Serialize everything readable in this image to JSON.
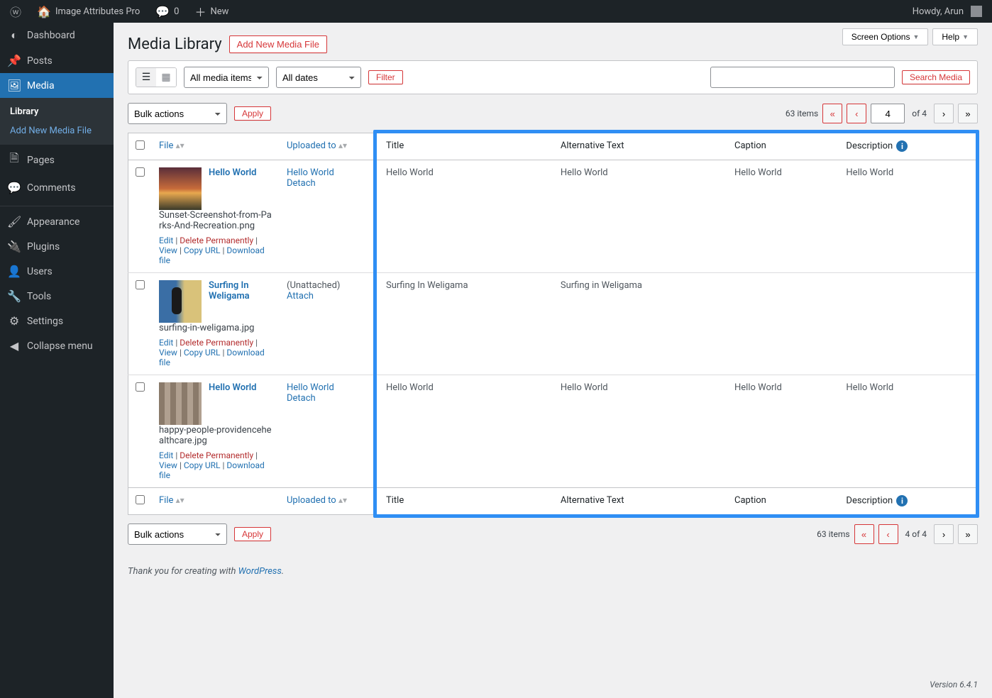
{
  "admin_bar": {
    "site_name": "Image Attributes Pro",
    "comments_count": "0",
    "new_label": "New",
    "howdy": "Howdy, Arun"
  },
  "sidebar": {
    "items": [
      {
        "label": "Dashboard",
        "icon": "◐"
      },
      {
        "label": "Posts",
        "icon": "📌"
      },
      {
        "label": "Media",
        "icon": "🖼",
        "current": true,
        "sub": [
          {
            "label": "Library",
            "current": true
          },
          {
            "label": "Add New Media File",
            "link": true
          }
        ]
      },
      {
        "label": "Pages",
        "icon": "🗎"
      },
      {
        "label": "Comments",
        "icon": "💬"
      },
      {
        "sep": true
      },
      {
        "label": "Appearance",
        "icon": "🖌"
      },
      {
        "label": "Plugins",
        "icon": "🔌"
      },
      {
        "label": "Users",
        "icon": "👤"
      },
      {
        "label": "Tools",
        "icon": "🔧"
      },
      {
        "label": "Settings",
        "icon": "⚙"
      },
      {
        "label": "Collapse menu",
        "icon": "◀"
      }
    ]
  },
  "top_buttons": {
    "screen_options": "Screen Options",
    "help": "Help"
  },
  "page": {
    "title": "Media Library",
    "add_new": "Add New Media File"
  },
  "filters": {
    "media_items": "All media items",
    "dates": "All dates",
    "filter_btn": "Filter",
    "search_btn": "Search Media"
  },
  "bulk": {
    "label": "Bulk actions",
    "apply": "Apply"
  },
  "pagination_top": {
    "items": "63 items",
    "page": "4",
    "of": "of 4"
  },
  "pagination_bottom": {
    "items": "63 items",
    "page_of": "4 of 4"
  },
  "columns": {
    "file": "File",
    "uploaded": "Uploaded to",
    "title": "Title",
    "alt": "Alternative Text",
    "caption": "Caption",
    "desc": "Description"
  },
  "row_actions": {
    "edit": "Edit",
    "delete": "Delete Permanently",
    "view": "View",
    "copy": "Copy URL",
    "download": "Download file",
    "detach": "Detach",
    "attach": "Attach",
    "unattached": "(Unattached)"
  },
  "rows": [
    {
      "thumb": "sunset",
      "name": "Hello World",
      "filename": "Sunset-Screenshot-from-Parks-And-Recreation.png",
      "uploaded": "Hello World",
      "uploaded_action": "Detach",
      "title": "Hello World",
      "alt": "Hello World",
      "caption": "Hello World",
      "desc": "Hello World"
    },
    {
      "thumb": "surf",
      "name": "Surfing In Weligama",
      "filename": "surfing-in-weligama.jpg",
      "uploaded": "(Unattached)",
      "uploaded_action": "Attach",
      "unattached": true,
      "title": "Surfing In Weligama",
      "alt": "Surfing in Weligama",
      "caption": "",
      "desc": ""
    },
    {
      "thumb": "people",
      "name": "Hello World",
      "filename": "happy-people-providencehealthcare.jpg",
      "uploaded": "Hello World",
      "uploaded_action": "Detach",
      "title": "Hello World",
      "alt": "Hello World",
      "caption": "Hello World",
      "desc": "Hello World"
    }
  ],
  "footer": {
    "thanks": "Thank you for creating with ",
    "wp": "WordPress",
    "period": ".",
    "version": "Version 6.4.1"
  }
}
